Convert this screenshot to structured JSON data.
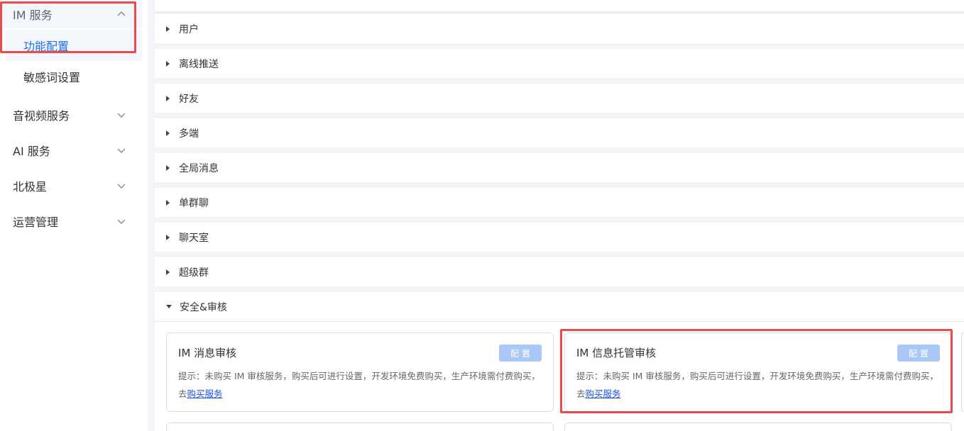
{
  "sidebar": {
    "groups": [
      {
        "label": "IM 服务",
        "expanded": true,
        "subitems": [
          "功能配置",
          "敏感词设置"
        ],
        "selected": "功能配置"
      },
      {
        "label": "音视频服务"
      },
      {
        "label": "AI 服务"
      },
      {
        "label": "北极星"
      },
      {
        "label": "运营管理"
      }
    ]
  },
  "sections": [
    "用户",
    "离线推送",
    "好友",
    "多端",
    "全局消息",
    "单群聊",
    "聊天室",
    "超级群",
    "安全&审核"
  ],
  "open_section": "安全&审核",
  "cards": [
    {
      "title": "IM 消息审核",
      "button": "配置",
      "desc": "提示：未购买 IM 审核服务，购买后可进行设置，开发环境免费购买，生产环境需付费购买，去",
      "link": "购买服务"
    },
    {
      "title": "IM 信息托管审核",
      "button": "配置",
      "desc": "提示：未购买 IM 审核服务，购买后可进行设置，开发环境免费购买，生产环境需付费购买，去",
      "link": "购买服务"
    }
  ],
  "colors": {
    "accent": "#1e6fe8",
    "highlight_box": "#e84c4c",
    "button_disabled": "#a9c8f7"
  }
}
